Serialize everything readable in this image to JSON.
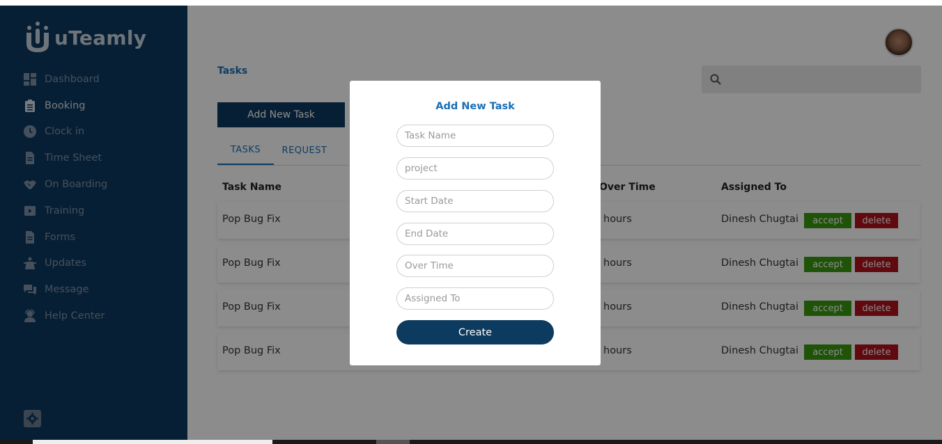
{
  "brand": {
    "name": "uTeamly"
  },
  "sidebar": {
    "items": [
      {
        "label": "Dashboard",
        "icon": "dashboard-icon"
      },
      {
        "label": "Booking",
        "icon": "clipboard-icon"
      },
      {
        "label": "Clock in",
        "icon": "clock-icon"
      },
      {
        "label": "Time Sheet",
        "icon": "document-icon"
      },
      {
        "label": "On Boarding",
        "icon": "handshake-icon"
      },
      {
        "label": "Training",
        "icon": "video-icon"
      },
      {
        "label": "Forms",
        "icon": "file-icon"
      },
      {
        "label": "Updates",
        "icon": "megaphone-icon"
      },
      {
        "label": "Message",
        "icon": "chat-icon"
      },
      {
        "label": "Help Center",
        "icon": "support-agent-icon"
      }
    ],
    "active_index": 1
  },
  "page": {
    "breadcrumb": "Tasks",
    "search_placeholder": "",
    "add_button": "Add New Task",
    "tabs": [
      "TASKS",
      "REQUEST"
    ]
  },
  "table": {
    "headers": {
      "task_name": "Task Name",
      "over_time": "Over Time",
      "assigned_to": "Assigned To"
    },
    "rows": [
      {
        "task_name": "Pop Bug Fix",
        "over_time": "hours",
        "assigned_to": "Dinesh Chugtai",
        "accept": "accept",
        "delete": "delete"
      },
      {
        "task_name": "Pop Bug Fix",
        "over_time": "hours",
        "assigned_to": "Dinesh Chugtai",
        "accept": "accept",
        "delete": "delete"
      },
      {
        "task_name": "Pop Bug Fix",
        "over_time": "hours",
        "assigned_to": "Dinesh Chugtai",
        "accept": "accept",
        "delete": "delete"
      },
      {
        "task_name": "Pop Bug Fix",
        "over_time": "hours",
        "assigned_to": "Dinesh Chugtai",
        "accept": "accept",
        "delete": "delete"
      }
    ]
  },
  "modal": {
    "title": "Add New Task",
    "fields": {
      "task_name": "Task Name",
      "project": "project",
      "start_date": "Start Date",
      "end_date": "End Date",
      "over_time": "Over Time",
      "assigned_to": "Assigned To"
    },
    "create_button": "Create"
  },
  "colors": {
    "sidebar_bg": "#0d3a5f",
    "primary": "#0d3a5f",
    "link": "#1a6fb5",
    "accept": "#3a9a10",
    "delete": "#b0121b"
  }
}
